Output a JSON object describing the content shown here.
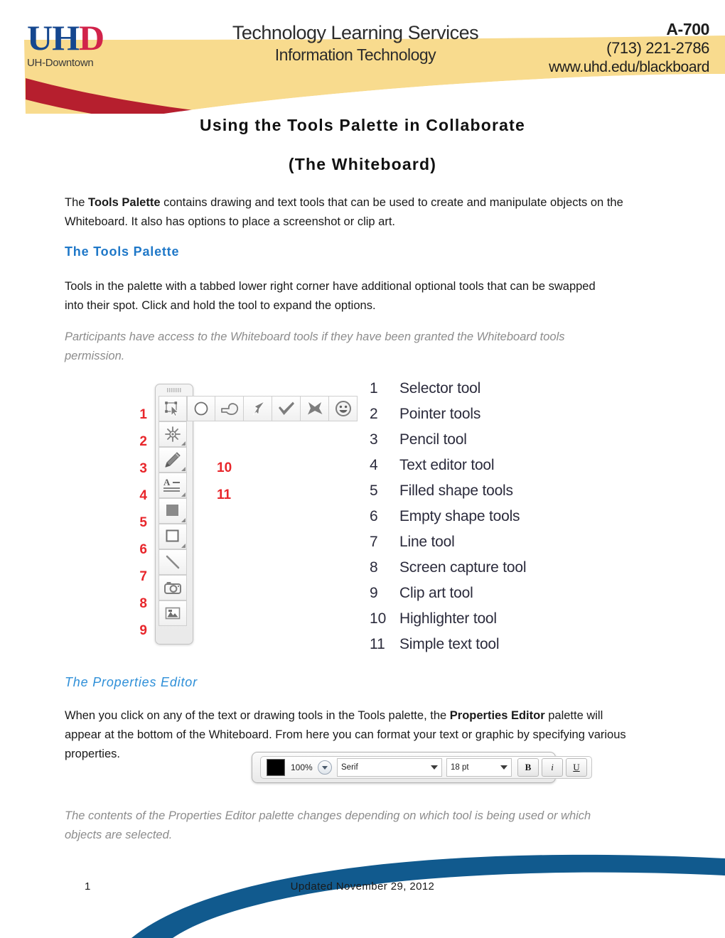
{
  "header": {
    "logo": {
      "primary": "UH",
      "accent": "D",
      "subtitle": "UH-Downtown"
    },
    "center_line1": "Technology Learning Services",
    "center_line2": "Information Technology",
    "room": "A-700",
    "phone": "(713) 221-2786",
    "url": "www.uhd.edu/blackboard",
    "colors": {
      "yellow": "#f8db8e",
      "red": "#b61f2e",
      "blue": "#15478f",
      "logo_red": "#d1234a"
    }
  },
  "title": "Using the Tools Palette in Collaborate",
  "subtitle": "(The Whiteboard)",
  "intro": {
    "part1": "The ",
    "bold1": "Tools Palette",
    "part2": " contains drawing and text tools that can be used to create and manipulate objects on the Whiteboard. It also has options to place a screenshot or clip art."
  },
  "section_tools": {
    "heading": "The Tools Palette",
    "paragraph": "Tools in the palette with a tabbed lower right corner have additional optional tools that can be swapped into their spot. Click and hold the tool to expand the options.",
    "note": "Participants have access to the Whiteboard tools if they have been granted the Whiteboard tools permission."
  },
  "palette_figure": {
    "left_numbers": [
      "1",
      "2",
      "3",
      "4",
      "5",
      "6",
      "7",
      "8",
      "9"
    ],
    "callout_10": "10",
    "callout_11": "11",
    "tools": [
      {
        "num": "1",
        "icon": "selector-tool-icon",
        "has_tab": false
      },
      {
        "num": "2",
        "icon": "sparkle-pointer-icon",
        "has_tab": true
      },
      {
        "num": "3",
        "icon": "pencil-tool-icon",
        "has_tab": true
      },
      {
        "num": "4",
        "icon": "text-editor-tool-icon",
        "has_tab": true
      },
      {
        "num": "5",
        "icon": "filled-square-icon",
        "has_tab": true
      },
      {
        "num": "6",
        "icon": "empty-square-icon",
        "has_tab": true
      },
      {
        "num": "7",
        "icon": "line-tool-icon",
        "has_tab": false
      },
      {
        "num": "8",
        "icon": "camera-icon",
        "has_tab": false
      },
      {
        "num": "9",
        "icon": "clip-art-icon",
        "has_tab": false
      }
    ],
    "pointer_flyout": [
      "sparkle-icon",
      "hand-point-left-icon",
      "hand-point-right-icon",
      "arrow-icon",
      "check-icon",
      "x-mark-icon",
      "smiley-icon"
    ],
    "pencil_flyout": [
      "highlighter-icon"
    ],
    "text_flyout": [
      "simple-text-a-icon"
    ],
    "filled_flyout": [
      "filled-circle-icon"
    ],
    "empty_flyout": [
      "empty-circle-icon"
    ],
    "legend": [
      {
        "num": "1",
        "label": "Selector tool"
      },
      {
        "num": "2",
        "label": "Pointer tools"
      },
      {
        "num": "3",
        "label": "Pencil tool"
      },
      {
        "num": "4",
        "label": "Text editor tool"
      },
      {
        "num": "5",
        "label": "Filled shape tools"
      },
      {
        "num": "6",
        "label": "Empty shape tools"
      },
      {
        "num": "7",
        "label": "Line tool"
      },
      {
        "num": "8",
        "label": "Screen capture tool"
      },
      {
        "num": "9",
        "label": "Clip art tool"
      },
      {
        "num": "10",
        "label": "Highlighter tool"
      },
      {
        "num": "11",
        "label": "Simple text tool"
      }
    ]
  },
  "section_properties": {
    "heading": "The Properties Editor",
    "p_part1": "When you click on any of the text or drawing tools in the Tools palette, the ",
    "p_bold": "Properties Editor",
    "p_part2": " palette will appear at the bottom of the Whiteboard. From here you can format your text or graphic by specifying various properties.",
    "note": "The contents of the Properties Editor palette changes depending on which tool is being used or which objects are selected."
  },
  "properties_editor_widget": {
    "color_swatch": "#000000",
    "opacity": "100%",
    "font_family": "Serif",
    "font_size": "18 pt",
    "bold_label": "B",
    "italic_label": "i",
    "underline_label": "U"
  },
  "footer": {
    "page_number": "1",
    "updated": "Updated November 29, 2012",
    "arc_color": "#115a8e"
  }
}
